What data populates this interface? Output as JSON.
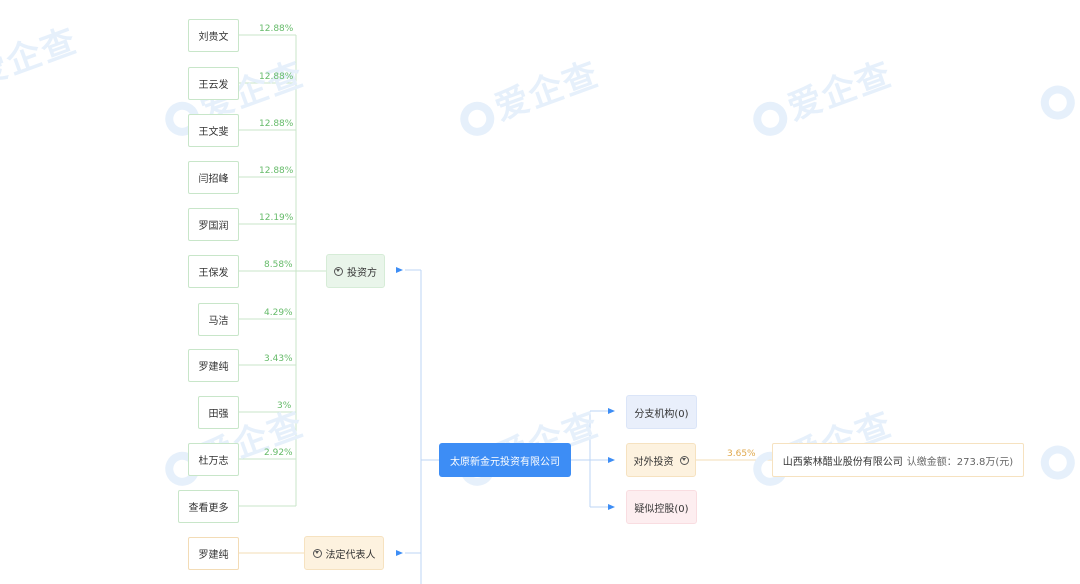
{
  "watermark": "爱企查",
  "shareholders": [
    {
      "name": "刘贵文",
      "pct": "12.88%"
    },
    {
      "name": "王云发",
      "pct": "12.88%"
    },
    {
      "name": "王文斐",
      "pct": "12.88%"
    },
    {
      "name": "闫招峰",
      "pct": "12.88%"
    },
    {
      "name": "罗国润",
      "pct": "12.19%"
    },
    {
      "name": "王保发",
      "pct": "8.58%"
    },
    {
      "name": "马洁",
      "pct": "4.29%"
    },
    {
      "name": "罗建纯",
      "pct": "3.43%"
    },
    {
      "name": "田强",
      "pct": "3%"
    },
    {
      "name": "杜万志",
      "pct": "2.92%"
    }
  ],
  "more_label": "查看更多",
  "investor_group_label": "投资方",
  "legal_rep": {
    "name": "罗建纯",
    "group_label": "法定代表人"
  },
  "center_company": "太原新金元投资有限公司",
  "branches_label": "分支机构(0)",
  "outbound_label": "对外投资",
  "suspected_control_label": "疑似控股(0)",
  "investment": {
    "pct": "3.65%",
    "company": "山西紫林醋业股份有限公司",
    "amount": "认缴金额：273.8万(元)"
  }
}
